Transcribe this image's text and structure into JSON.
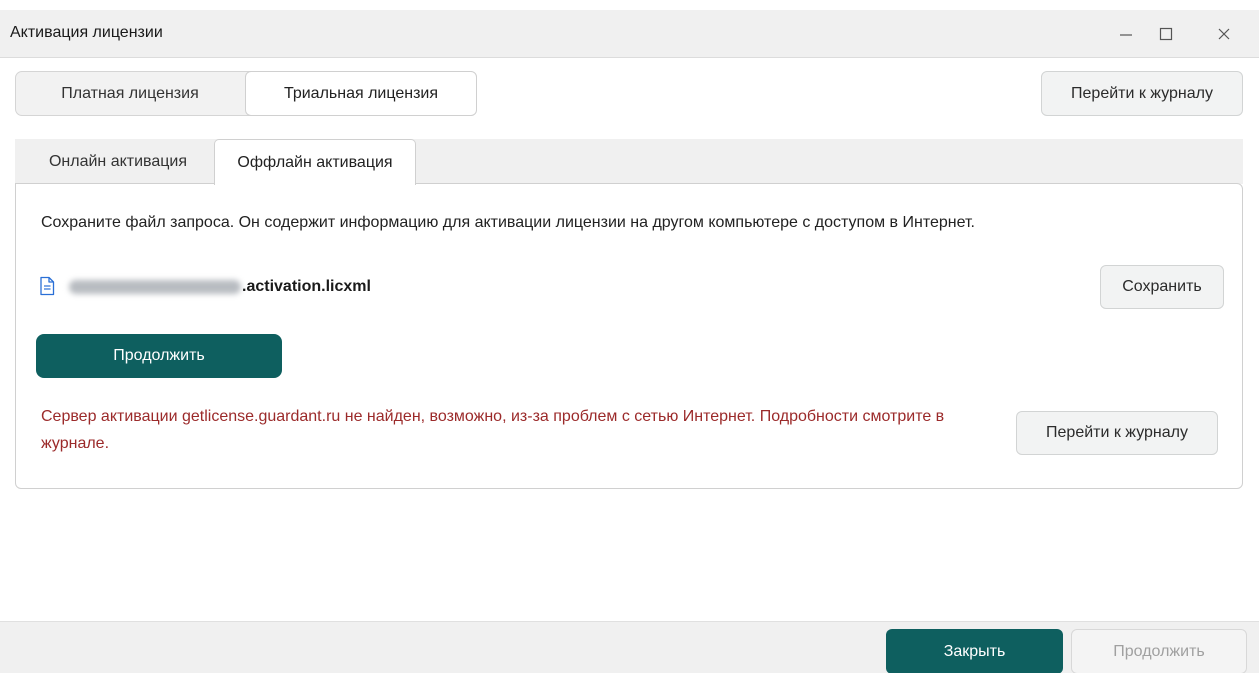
{
  "window": {
    "title": "Активация лицензии"
  },
  "license_type": {
    "paid_label": "Платная лицензия",
    "trial_label": "Триальная лицензия",
    "selected": "trial"
  },
  "header": {
    "journal_button": "Перейти к журналу"
  },
  "tabs": {
    "online_label": "Онлайн активация",
    "offline_label": "Оффлайн активация",
    "active": "offline"
  },
  "offline": {
    "description": "Сохраните файл запроса. Он содержит информацию для активации лицензии на другом компьютере с доступом в Интернет.",
    "file_suffix": ".activation.licxml",
    "save_button": "Сохранить",
    "continue_button": "Продолжить",
    "error_message": "Сервер активации getlicense.guardant.ru не найден, возможно, из-за проблем с сетью Интернет. Подробности смотрите в журнале.",
    "journal_button": "Перейти к журналу"
  },
  "footer": {
    "close_button": "Закрыть",
    "continue_button": "Продолжить"
  },
  "colors": {
    "primary": "#0e5f5f",
    "error": "#9b2a2a"
  },
  "icons": {
    "minimize": "minimize-icon",
    "maximize": "maximize-icon",
    "close": "close-icon",
    "file": "document-icon"
  }
}
